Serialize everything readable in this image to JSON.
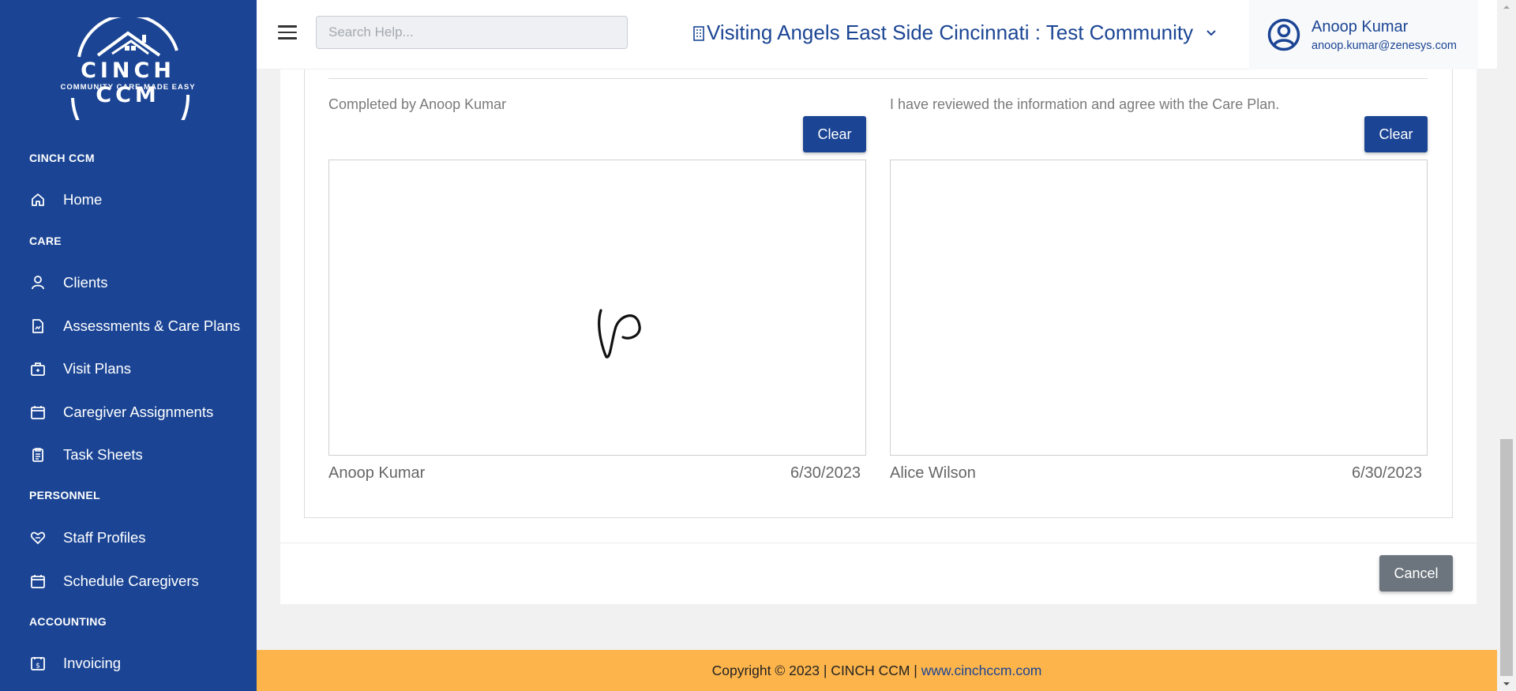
{
  "sidebar": {
    "logo_text": "CINCH CCM",
    "logo_tagline": "COMMUNITY CARE MADE EASY",
    "sections": {
      "cinch": "CINCH CCM",
      "care": "CARE",
      "personnel": "PERSONNEL",
      "accounting": "ACCOUNTING"
    },
    "items": {
      "home": "Home",
      "clients": "Clients",
      "assessments": "Assessments & Care Plans",
      "visit_plans": "Visit Plans",
      "caregiver_assignments": "Caregiver Assignments",
      "task_sheets": "Task Sheets",
      "staff_profiles": "Staff Profiles",
      "schedule_caregivers": "Schedule Caregivers",
      "invoicing": "Invoicing"
    }
  },
  "header": {
    "search_placeholder": "Search Help...",
    "community": "Visiting Angels East Side Cincinnati : Test Community",
    "user_name": "Anoop Kumar",
    "user_email": "anoop.kumar@zenesys.com"
  },
  "signatures": {
    "left": {
      "caption": "Completed by Anoop Kumar",
      "clear_label": "Clear",
      "name": "Anoop Kumar",
      "date": "6/30/2023"
    },
    "right": {
      "caption": "I have reviewed the information and agree with the Care Plan.",
      "clear_label": "Clear",
      "name": "Alice Wilson",
      "date": "6/30/2023"
    }
  },
  "actions": {
    "cancel_label": "Cancel"
  },
  "footer": {
    "copyright": "Copyright © 2023 | CINCH CCM | ",
    "link": "www.cinchccm.com"
  },
  "colors": {
    "primary": "#1b4594",
    "footer_bg": "#fdb44b",
    "cancel_bg": "#6c757d"
  }
}
